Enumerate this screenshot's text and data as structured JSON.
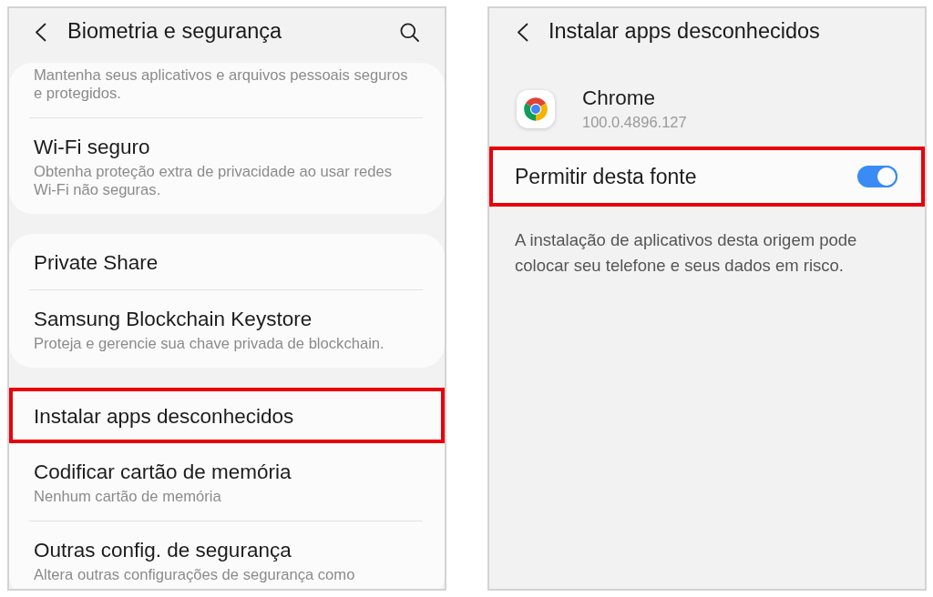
{
  "settings_screen": {
    "title": "Biometria e segurança",
    "groups": [
      {
        "items": [
          {
            "subtitle": "Mantenha seus aplicativos e arquivos pessoais seguros e protegidos.",
            "highlighted": false
          },
          {
            "title": "Wi-Fi seguro",
            "subtitle": "Obtenha proteção extra de privacidade ao usar redes Wi-Fi não seguras.",
            "highlighted": false
          }
        ]
      },
      {
        "items": [
          {
            "title": "Private Share",
            "highlighted": false
          },
          {
            "title": "Samsung Blockchain Keystore",
            "subtitle": "Proteja e gerencie sua chave privada de blockchain.",
            "highlighted": false
          }
        ]
      },
      {
        "items": [
          {
            "title": "Instalar apps desconhecidos",
            "highlighted": true
          },
          {
            "title": "Codificar cartão de memória",
            "subtitle": "Nenhum cartão de memória",
            "highlighted": false
          },
          {
            "title": "Outras config. de segurança",
            "subtitle": "Altera outras configurações de segurança como",
            "highlighted": false
          }
        ]
      }
    ]
  },
  "app_screen": {
    "title": "Instalar apps desconhecidos",
    "app": {
      "name": "Chrome",
      "version": "100.0.4896.127"
    },
    "setting": {
      "label": "Permitir desta fonte",
      "on": true,
      "highlighted": true
    },
    "description": "A instalação de aplicativos desta origem pode colocar seu telefone e seus dados em risco."
  }
}
